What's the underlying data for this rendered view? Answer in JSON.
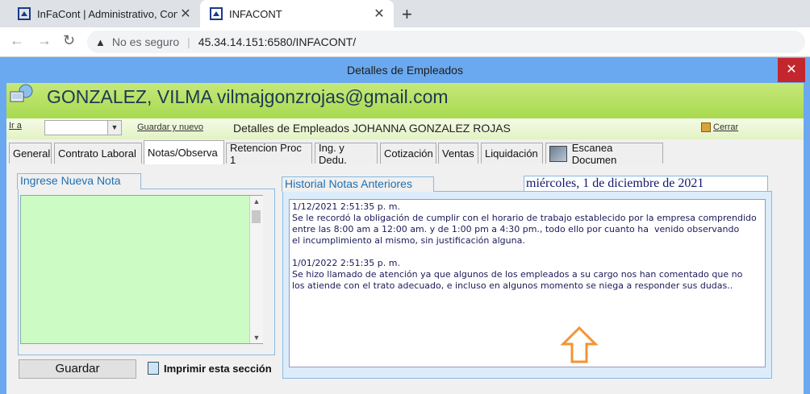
{
  "browser": {
    "tabs": [
      {
        "title": "InFaCont | Administrativo, Contab"
      },
      {
        "title": "INFACONT"
      }
    ],
    "security_label": "No es seguro",
    "url": "45.34.14.151:6580/INFACONT/"
  },
  "window": {
    "title": "Detalles de Empleados",
    "close_glyph": "✕"
  },
  "header": {
    "employee_line": "GONZALEZ, VILMA vilmajgonzrojas@gmail.com"
  },
  "toolbar": {
    "ir_a_label": "Ir a",
    "ir_a_value": "",
    "save_new_label": "Guardar y nuevo",
    "details_title": "Detalles de Empleados JOHANNA GONZALEZ ROJAS",
    "close_label": "Cerrar"
  },
  "tabs": [
    {
      "label": "General"
    },
    {
      "label": "Contrato Laboral"
    },
    {
      "label": "Notas/Observa"
    },
    {
      "label": "Retencion Proc 1"
    },
    {
      "label": "Ing. y Dedu."
    },
    {
      "label": "Cotización"
    },
    {
      "label": "Ventas"
    },
    {
      "label": "Liquidación"
    },
    {
      "label": "Escanea Documen"
    }
  ],
  "notes": {
    "new_note_legend": "Ingrese Nueva Nota",
    "new_note_value": "",
    "save_button": "Guardar",
    "print_label": "Imprimir esta sección",
    "history_legend": "Historial Notas Anteriores",
    "date": "miércoles, 1 de diciembre de 2021",
    "history_text": "1/12/2021 2:51:35 p. m.\nSe le recordó la obligación de cumplir con el horario de trabajo establecido por la empresa comprendido\nentre las 8:00 am a 12:00 am. y de 1:00 pm a 4:30 pm., todo ello por cuanto ha  venido observando\nel incumplimiento al mismo, sin justificación alguna.\n\n1/01/2022 2:51:35 p. m.\nSe hizo llamado de atención ya que algunos de los empleados a su cargo nos han comentado que no\nlos atiende con el trato adecuado, e incluso en algunos momento se niega a responder sus dudas.."
  }
}
